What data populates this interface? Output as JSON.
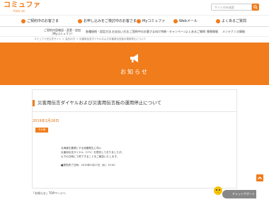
{
  "header": {
    "logo_main": "コミュファ",
    "logo_sub": "from ctc",
    "search_placeholder": "サイト内を検索"
  },
  "main_nav": [
    {
      "label": "ご契約中のお客さま",
      "icon": "person-icon"
    },
    {
      "label": "お申し込みをご検討中のお客さま",
      "icon": "cart-icon"
    },
    {
      "label": "Myコミュファ",
      "icon": "user-circle-icon"
    },
    {
      "label": "Webメール",
      "icon": "mail-icon"
    },
    {
      "label": "よくあるご質問",
      "icon": "question-icon"
    }
  ],
  "sub_nav": {
    "left_line1": "ご契約内容確認・変更・追加",
    "left_line2": "（Myコミュファ）",
    "items": [
      "各種接続・設定方法",
      "お支払い方法",
      "ご契約中のお客さま向け特典・キャンペーン",
      "よくあるご質問",
      "障害情報",
      "メンテナンス情報"
    ]
  },
  "breadcrumb": "コミュファ光公式サイト ＞ 会社の方 ＞ 災害用伝言ダイヤルおよび災害用伝言板の運用停止について",
  "banner": {
    "title": "お知らせ"
  },
  "article": {
    "title": "災害用伝言ダイヤルおよび災害用伝言板の運用停止について",
    "date": "2019年2月26日",
    "tag": "その他",
    "body": [
      "北海道を震源とする地震発生に伴い",
      "災害用伝言ダイヤル（171）を提供しておりましたが、",
      "以下の日時にて終了することをご報告いたします。",
      "",
      "■提供終了日時：2019年2月27日（水）15:00"
    ]
  },
  "footer": {
    "link": "「お知らせ」TOPページへ"
  },
  "chatbot": {
    "label": "チャットサポート"
  },
  "colors": {
    "accent": "#f07c1b"
  }
}
